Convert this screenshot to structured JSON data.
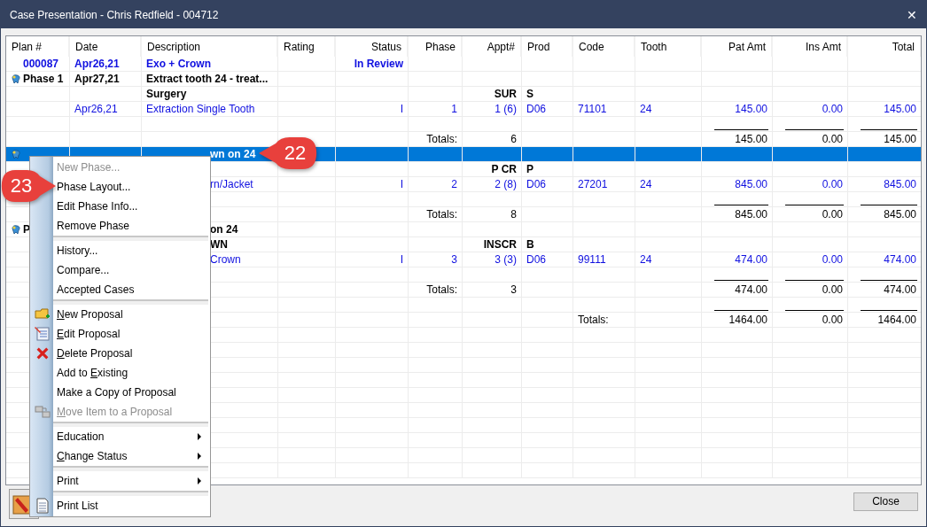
{
  "window": {
    "title": "Case Presentation - Chris Redfield - 004712",
    "close_glyph": "✕"
  },
  "table": {
    "columns": [
      "Plan #",
      "Date",
      "Description",
      "Rating",
      "Status",
      "Phase",
      "Appt#",
      "Prod",
      "Code",
      "Tooth",
      "Pat Amt",
      "Ins Amt",
      "Total"
    ],
    "rows": [
      {
        "kind": "plan",
        "selected": false,
        "cells": {
          "plan": "000087",
          "date": "Apr26,21",
          "description": "Exo + Crown",
          "status": "In Review"
        }
      },
      {
        "kind": "phase",
        "selected": false,
        "cells": {
          "plan": "Phase 1",
          "date": "Apr27,21",
          "description": "Extract tooth 24 - treat..."
        }
      },
      {
        "kind": "group",
        "selected": false,
        "cells": {
          "description": "Surgery",
          "appt": "SUR",
          "prod": "S"
        }
      },
      {
        "kind": "item",
        "selected": false,
        "cells": {
          "date": "Apr26,21",
          "description": "Extraction Single Tooth",
          "status": "I",
          "phase": "1",
          "appt": "1 (6)",
          "prod": "D06",
          "code": "71101",
          "tooth": "24",
          "pat_amt": "145.00",
          "ins_amt": "0.00",
          "total": "145.00"
        }
      },
      {
        "kind": "rules",
        "selected": false,
        "cells": {}
      },
      {
        "kind": "totals",
        "selected": false,
        "cells": {
          "phase": "Totals:",
          "appt": "6",
          "pat_amt": "145.00",
          "ins_amt": "0.00",
          "total": "145.00"
        }
      },
      {
        "kind": "phase",
        "selected": true,
        "cells": {
          "description": "wn on 24"
        }
      },
      {
        "kind": "group",
        "selected": false,
        "cells": {
          "appt": "P CR",
          "prod": "P"
        }
      },
      {
        "kind": "item",
        "selected": false,
        "cells": {
          "description": "rn/Jacket",
          "status": "I",
          "phase": "2",
          "appt": "2 (8)",
          "prod": "D06",
          "code": "27201",
          "tooth": "24",
          "pat_amt": "845.00",
          "ins_amt": "0.00",
          "total": "845.00"
        }
      },
      {
        "kind": "rules",
        "selected": false,
        "cells": {}
      },
      {
        "kind": "totals",
        "selected": false,
        "cells": {
          "phase": "Totals:",
          "appt": "8",
          "pat_amt": "845.00",
          "ins_amt": "0.00",
          "total": "845.00"
        }
      },
      {
        "kind": "phase",
        "selected": false,
        "cells": {
          "plan": "P",
          "description": "on 24"
        }
      },
      {
        "kind": "group",
        "selected": false,
        "cells": {
          "description": "WN",
          "appt": "INSCR",
          "prod": "B"
        }
      },
      {
        "kind": "item",
        "selected": false,
        "cells": {
          "description": "Crown",
          "status": "I",
          "phase": "3",
          "appt": "3 (3)",
          "prod": "D06",
          "code": "99111",
          "tooth": "24",
          "pat_amt": "474.00",
          "ins_amt": "0.00",
          "total": "474.00"
        }
      },
      {
        "kind": "rules",
        "selected": false,
        "cells": {}
      },
      {
        "kind": "totals",
        "selected": false,
        "cells": {
          "phase": "Totals:",
          "appt": "3",
          "pat_amt": "474.00",
          "ins_amt": "0.00",
          "total": "474.00"
        }
      },
      {
        "kind": "rules",
        "selected": false,
        "cells": {}
      },
      {
        "kind": "grand_total",
        "selected": false,
        "cells": {
          "code": "Totals:",
          "pat_amt": "1464.00",
          "ins_amt": "0.00",
          "total": "1464.00"
        }
      }
    ]
  },
  "context_menu": {
    "items": [
      {
        "kind": "item",
        "label": "New Phase...",
        "disabled": true,
        "submenu": false
      },
      {
        "kind": "item",
        "label": "Phase Layout...",
        "disabled": false,
        "submenu": false
      },
      {
        "kind": "item",
        "label": "Edit Phase Info...",
        "disabled": false,
        "submenu": false
      },
      {
        "kind": "item",
        "label": "Remove Phase",
        "disabled": false,
        "submenu": false
      },
      {
        "kind": "separator"
      },
      {
        "kind": "item",
        "label": "History...",
        "disabled": false,
        "submenu": false
      },
      {
        "kind": "item",
        "label": "Compare...",
        "disabled": false,
        "submenu": false
      },
      {
        "kind": "item",
        "label": "Accepted Cases",
        "disabled": false,
        "submenu": false
      },
      {
        "kind": "separator"
      },
      {
        "kind": "item",
        "key": "N",
        "post": "ew Proposal",
        "disabled": false,
        "submenu": false
      },
      {
        "kind": "item",
        "key": "E",
        "post": "dit Proposal",
        "disabled": false,
        "submenu": false
      },
      {
        "kind": "item",
        "key": "D",
        "post": "elete Proposal",
        "disabled": false,
        "submenu": false
      },
      {
        "kind": "item",
        "pre": "Add to ",
        "key": "E",
        "post": "xisting",
        "disabled": false,
        "submenu": false
      },
      {
        "kind": "item",
        "label": "Make a Copy of Proposal",
        "disabled": false,
        "submenu": false
      },
      {
        "kind": "item",
        "key": "M",
        "post": "ove Item to a Proposal",
        "disabled": true,
        "submenu": false
      },
      {
        "kind": "separator"
      },
      {
        "kind": "item",
        "label": "Education",
        "disabled": false,
        "submenu": true
      },
      {
        "kind": "item",
        "key": "C",
        "post": "hange Status",
        "disabled": false,
        "submenu": true
      },
      {
        "kind": "separator"
      },
      {
        "kind": "item",
        "label": "Print",
        "disabled": false,
        "submenu": true
      },
      {
        "kind": "separator"
      },
      {
        "kind": "item",
        "label": "Print List",
        "disabled": false,
        "submenu": false
      }
    ]
  },
  "callouts": [
    {
      "number": "22"
    },
    {
      "number": "23"
    }
  ],
  "buttons": {
    "close": "Close"
  }
}
